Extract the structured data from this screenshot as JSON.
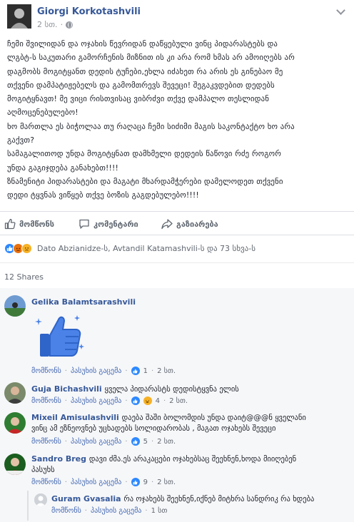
{
  "post": {
    "author": "Giorgi Korkotashvili",
    "time": "2 სთ.",
    "lines": [
      "ჩემი შვილიდან და ოჯახის წევრიდან დაწყებული ვინც პიდარასტებს და",
      "ლგბტ-ს საკუთარი გამორჩენის მიზნით ის კი არა რომ ხმას არ ამოიღებს არ",
      "დაგმობს მოგიტყანთ დედის ტუჩები,ეხლა იძახეთ რა არის ეს გინებაო მე",
      "თქვენი დამპატიჟებელს და გამომთრევს შევეცი! შეგაკვდებით დედებს",
      "მოგიტყნავთ! მე ვიცი რისთვისაც ვიბრძვი თქვე დამპალო თესლიდან",
      "აღმოცენებულებო!",
      "ხო მართლა ეს ბიჭოლაა თუ რაღაცა ჩემი სიძიმი მაგის საკონტაქტო ხო არა",
      "გაქვთ?",
      "სამაგალითოდ უნდა მოგიტყნათ დამხმელი დედეის წაწოვი რძე როგორ",
      "უნდა გაგიჯდება განახებთ!!!!",
      "ზნამენიტი პიდარასტები და მაგატი მხარდამჭერები დამელოდეთ თქვენი",
      "დედი ტყვნას ვიწყებ თქვე ბოზის გაგდებულებო!!!!"
    ]
  },
  "actions": {
    "like": "მომწონს",
    "comment": "კომენტარი",
    "share": "გაზიარება"
  },
  "reactions": {
    "summary": "Dato Abzianidze-ს, Avtandil Katamashvili-ს და 73 სხვა-ს",
    "types": [
      "like-icon",
      "angry-icon",
      "sad-icon"
    ]
  },
  "shares": "12 Shares",
  "comment_actions": {
    "like": "მომწონს",
    "reply": "პასუხის გაცემა"
  },
  "comments": [
    {
      "name": "Gelika Balamtsarashvili",
      "text": "",
      "likes": "1",
      "time": "2 სთ."
    },
    {
      "name": "Guja Bichashvili",
      "text": "ყველა პიდარასტს დედისტყვნა ელის",
      "likes": "4",
      "time": "2 სთ."
    },
    {
      "name": "Mixeil Amisulashvili",
      "text_line1": "დაება შაში ბოლომდის უნდა დაიტ@@@ნ ყველანი",
      "text_line2": "ვინც ამ ეზნეოვნებ უცხადებს სოლიდარობას , მაგათ ოჯახებს შევეცი",
      "likes": "5",
      "time": "2 სთ."
    },
    {
      "name": "Sandro Breg",
      "text_line1": "დავი ძმა.ეს არაკაცები ოჯახებსაც შეეხნენ,ხოდა მიიღებენ",
      "text_line2": "პასუხს",
      "likes": "9",
      "time": "2 სთ."
    }
  ],
  "reply": {
    "name": "Guram Gvasalia",
    "text": "რა ოჯახებს შეეხნენ,იქნებ მიტხრა სანდრიკ რა ხდება",
    "time": "1 სთ"
  },
  "colors": {
    "link": "#365899",
    "like_blue": "#2d88ff",
    "muted": "#90949c"
  }
}
